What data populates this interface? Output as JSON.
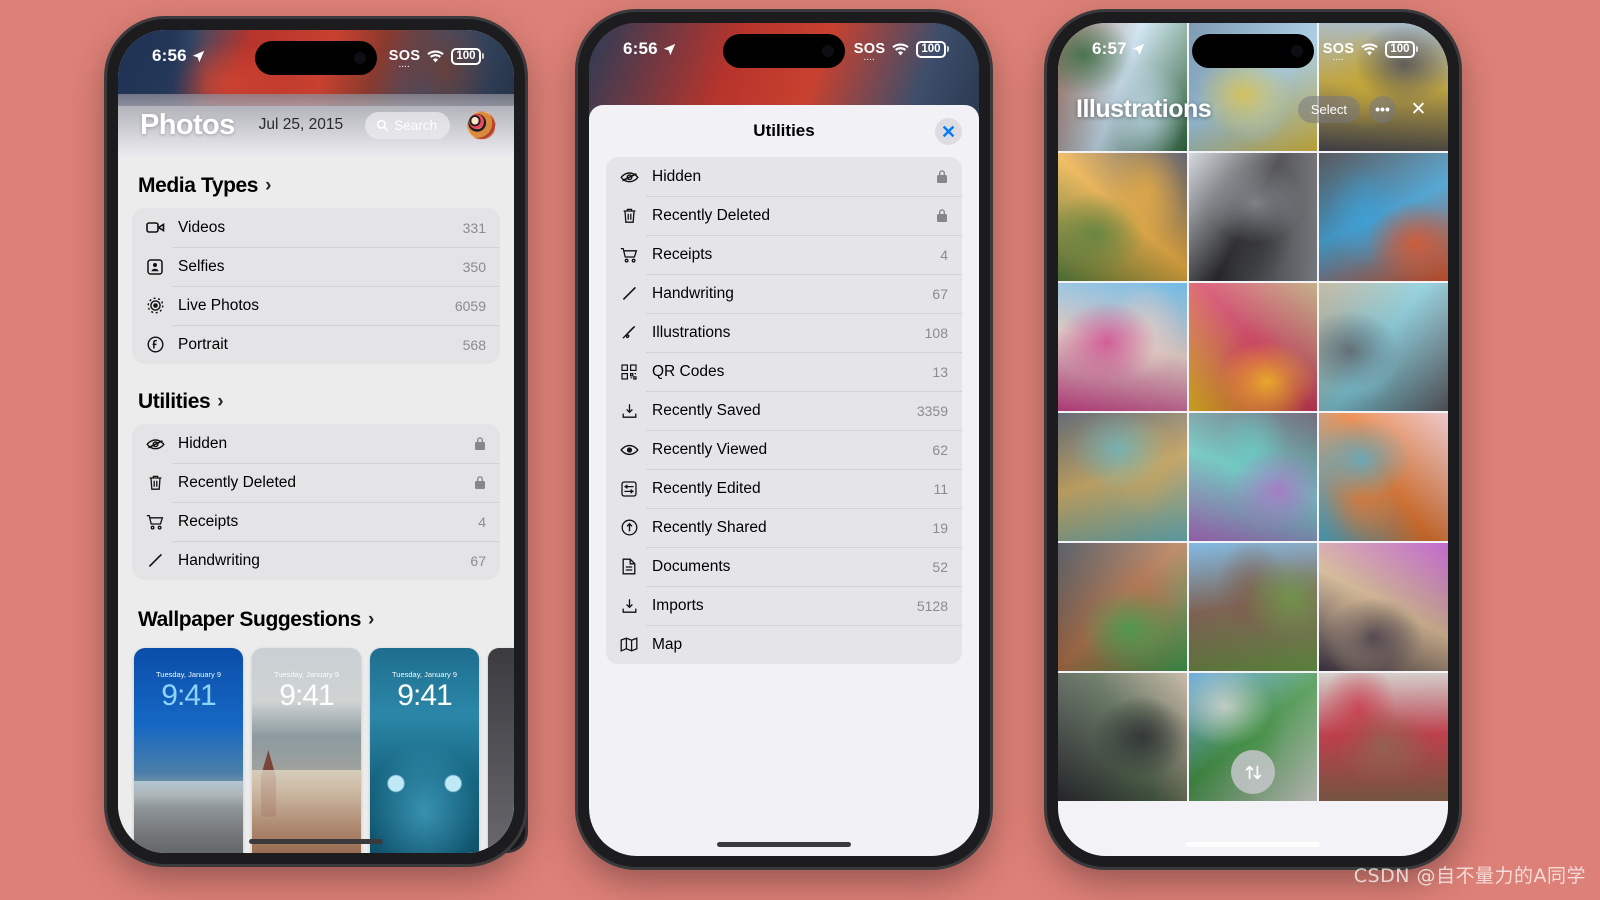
{
  "background_color": "#dd8077",
  "watermark": "CSDN @自不量力的A同学",
  "phone1": {
    "status": {
      "time": "6:56",
      "sos": "SOS",
      "battery": "100"
    },
    "header": {
      "title": "Photos",
      "date": "Jul 25, 2015",
      "search_label": "Search"
    },
    "sections": [
      {
        "title": "Media Types",
        "items": [
          {
            "icon": "video-icon",
            "label": "Videos",
            "count": "331"
          },
          {
            "icon": "selfie-icon",
            "label": "Selfies",
            "count": "350"
          },
          {
            "icon": "live-photo-icon",
            "label": "Live Photos",
            "count": "6059"
          },
          {
            "icon": "portrait-icon",
            "label": "Portrait",
            "count": "568"
          }
        ]
      },
      {
        "title": "Utilities",
        "items": [
          {
            "icon": "eye-slash-icon",
            "label": "Hidden",
            "count": "",
            "locked": true
          },
          {
            "icon": "trash-icon",
            "label": "Recently Deleted",
            "count": "",
            "locked": true
          },
          {
            "icon": "cart-icon",
            "label": "Receipts",
            "count": "4"
          },
          {
            "icon": "pencil-icon",
            "label": "Handwriting",
            "count": "67"
          }
        ]
      }
    ],
    "wallpaper_section": {
      "title": "Wallpaper Suggestions",
      "cards": [
        {
          "day": "Tuesday, January 9",
          "time": "9:41",
          "scene": "beach"
        },
        {
          "day": "Tuesday, January 9",
          "time": "9:41",
          "scene": "city"
        },
        {
          "day": "Tuesday, January 9",
          "time": "9:41",
          "scene": "cat"
        }
      ]
    }
  },
  "phone2": {
    "status": {
      "time": "6:56",
      "sos": "SOS",
      "battery": "100"
    },
    "sheet": {
      "title": "Utilities",
      "close_icon": "close-icon",
      "items": [
        {
          "icon": "eye-slash-icon",
          "label": "Hidden",
          "count": "",
          "locked": true
        },
        {
          "icon": "trash-icon",
          "label": "Recently Deleted",
          "count": "",
          "locked": true
        },
        {
          "icon": "cart-icon",
          "label": "Receipts",
          "count": "4"
        },
        {
          "icon": "pencil-icon",
          "label": "Handwriting",
          "count": "67"
        },
        {
          "icon": "scribble-icon",
          "label": "Illustrations",
          "count": "108"
        },
        {
          "icon": "qrcode-icon",
          "label": "QR Codes",
          "count": "13"
        },
        {
          "icon": "save-icon",
          "label": "Recently Saved",
          "count": "3359"
        },
        {
          "icon": "eye-icon",
          "label": "Recently Viewed",
          "count": "62"
        },
        {
          "icon": "sliders-icon",
          "label": "Recently Edited",
          "count": "11"
        },
        {
          "icon": "share-circle-icon",
          "label": "Recently Shared",
          "count": "19"
        },
        {
          "icon": "document-icon",
          "label": "Documents",
          "count": "52"
        },
        {
          "icon": "import-icon",
          "label": "Imports",
          "count": "5128"
        },
        {
          "icon": "map-icon",
          "label": "Map",
          "count": ""
        }
      ]
    }
  },
  "phone3": {
    "status": {
      "time": "6:57",
      "sos": "SOS",
      "battery": "100"
    },
    "title": "Illustrations",
    "actions": {
      "select_label": "Select",
      "more_label": "•••",
      "close_label": "✕"
    },
    "fab_icon": "sort-arrows-icon",
    "grid": [
      {
        "name": "mural-house-red",
        "c1": "#8d5440",
        "c2": "#c9e2f2",
        "c3": "#2f6a3e"
      },
      {
        "name": "mural-birds-blue",
        "c1": "#5a7f9c",
        "c2": "#9ecbe8",
        "c3": "#e0c040"
      },
      {
        "name": "mural-alley-yellow",
        "c1": "#8fa8c4",
        "c2": "#c8a832",
        "c3": "#4a4a52"
      },
      {
        "name": "mural-roses",
        "c1": "#3c3a46",
        "c2": "#f0b040",
        "c3": "#58823f"
      },
      {
        "name": "mural-bw-barn",
        "c1": "#c9cfd6",
        "c2": "#2c2c2e",
        "c3": "#8c9299"
      },
      {
        "name": "mural-geometric",
        "c1": "#2a2a30",
        "c2": "#3aa0d8",
        "c3": "#e0562c"
      },
      {
        "name": "mural-bees-pink",
        "c1": "#49a8e0",
        "c2": "#e8cfc8",
        "c3": "#d0468e"
      },
      {
        "name": "mural-graffiti-s",
        "c1": "#b59a6a",
        "c2": "#d23a5c",
        "c3": "#f0c020"
      },
      {
        "name": "mural-street-blue",
        "c1": "#b6a88c",
        "c2": "#7ec8d8",
        "c3": "#5c5c62"
      },
      {
        "name": "mural-circles",
        "c1": "#3a4450",
        "c2": "#c9a45a",
        "c3": "#6cb8c0"
      },
      {
        "name": "mural-purple-wall",
        "c1": "#4c4458",
        "c2": "#6ad0c8",
        "c3": "#b070c8"
      },
      {
        "name": "mural-rainbow-pink",
        "c1": "#e8b8bc",
        "c2": "#e8762c",
        "c3": "#50b0d0"
      },
      {
        "name": "mural-rabbit",
        "c1": "#2e3642",
        "c2": "#b07048",
        "c3": "#40a050"
      },
      {
        "name": "mural-brick-grass",
        "c1": "#5fa8dc",
        "c2": "#7c5a48",
        "c3": "#6c9c48"
      },
      {
        "name": "mural-flowers-neon",
        "c1": "#b040c0",
        "c2": "#d8b890",
        "c3": "#403848"
      },
      {
        "name": "mural-living-room",
        "c1": "#b8a890",
        "c2": "#4c6048",
        "c3": "#2c2c32"
      },
      {
        "name": "mural-green-box",
        "c1": "#4a9ad8",
        "c2": "#3c9040",
        "c3": "#d8d8d4"
      },
      {
        "name": "mural-strawberry",
        "c1": "#c8c4c0",
        "c2": "#c82c3c",
        "c3": "#8c6850"
      }
    ]
  }
}
